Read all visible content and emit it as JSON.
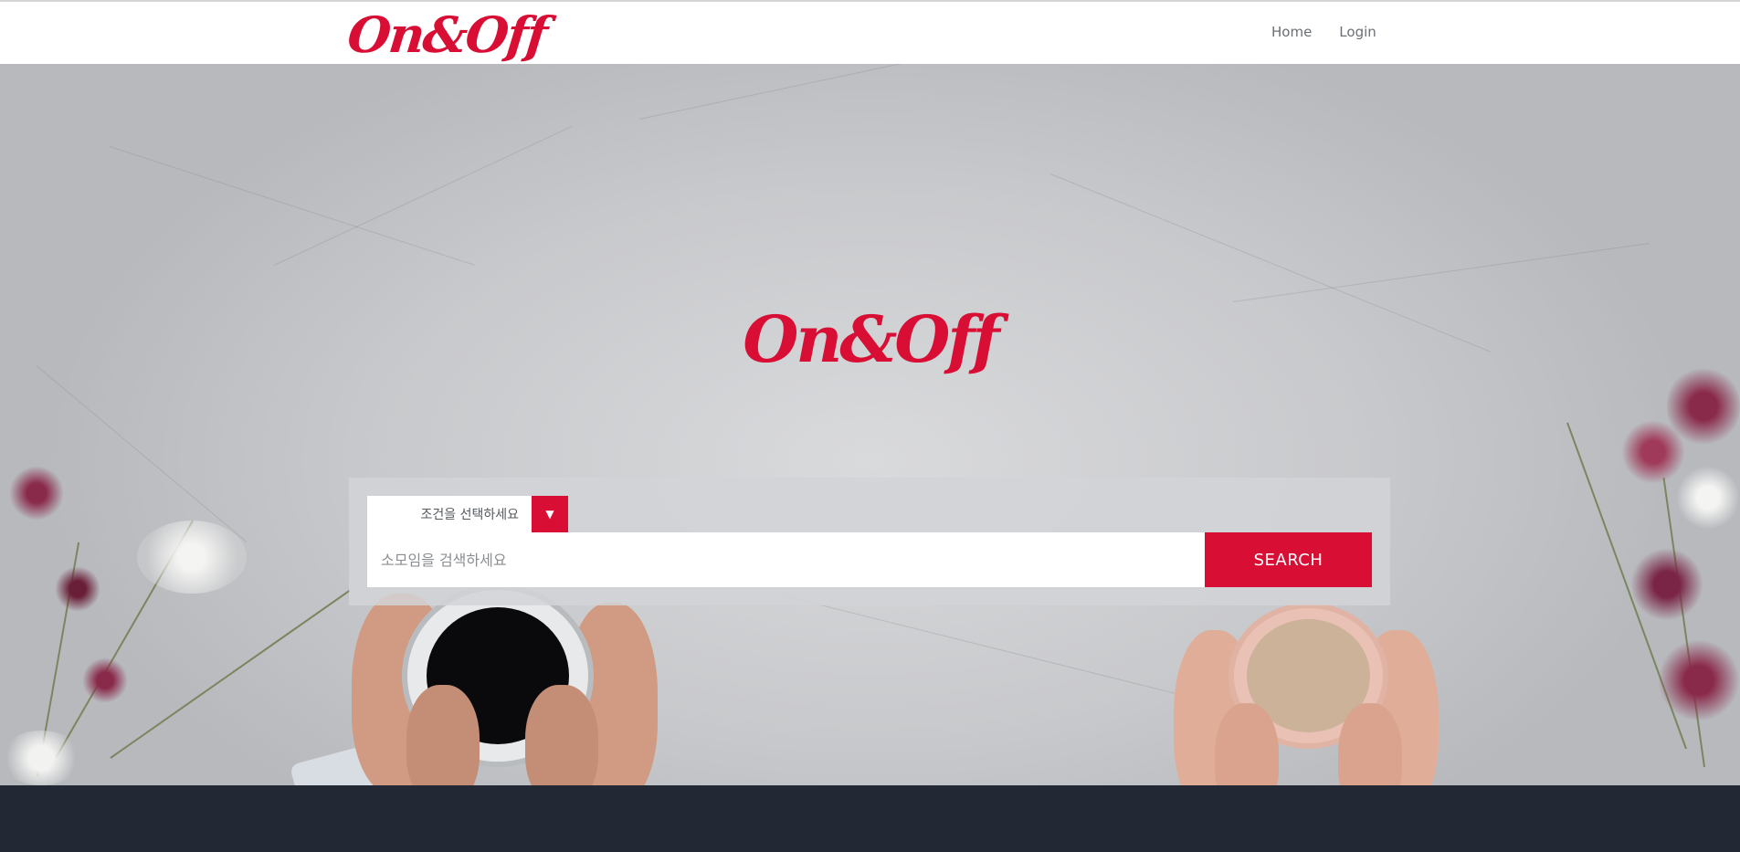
{
  "brand": {
    "name": "On&Off",
    "color": "#d90e34"
  },
  "nav": {
    "items": [
      {
        "label": "Home"
      },
      {
        "label": "Login"
      }
    ]
  },
  "hero": {
    "logo_text": "On&Off"
  },
  "search": {
    "condition_placeholder": "조건을 선택하세요",
    "dropdown_icon": "caret-down-icon",
    "input_placeholder": "소모임을 검색하세요",
    "button_label": "SEARCH"
  },
  "colors": {
    "accent": "#d90e34",
    "footer": "#222934",
    "panel": "#d2d4d7"
  }
}
